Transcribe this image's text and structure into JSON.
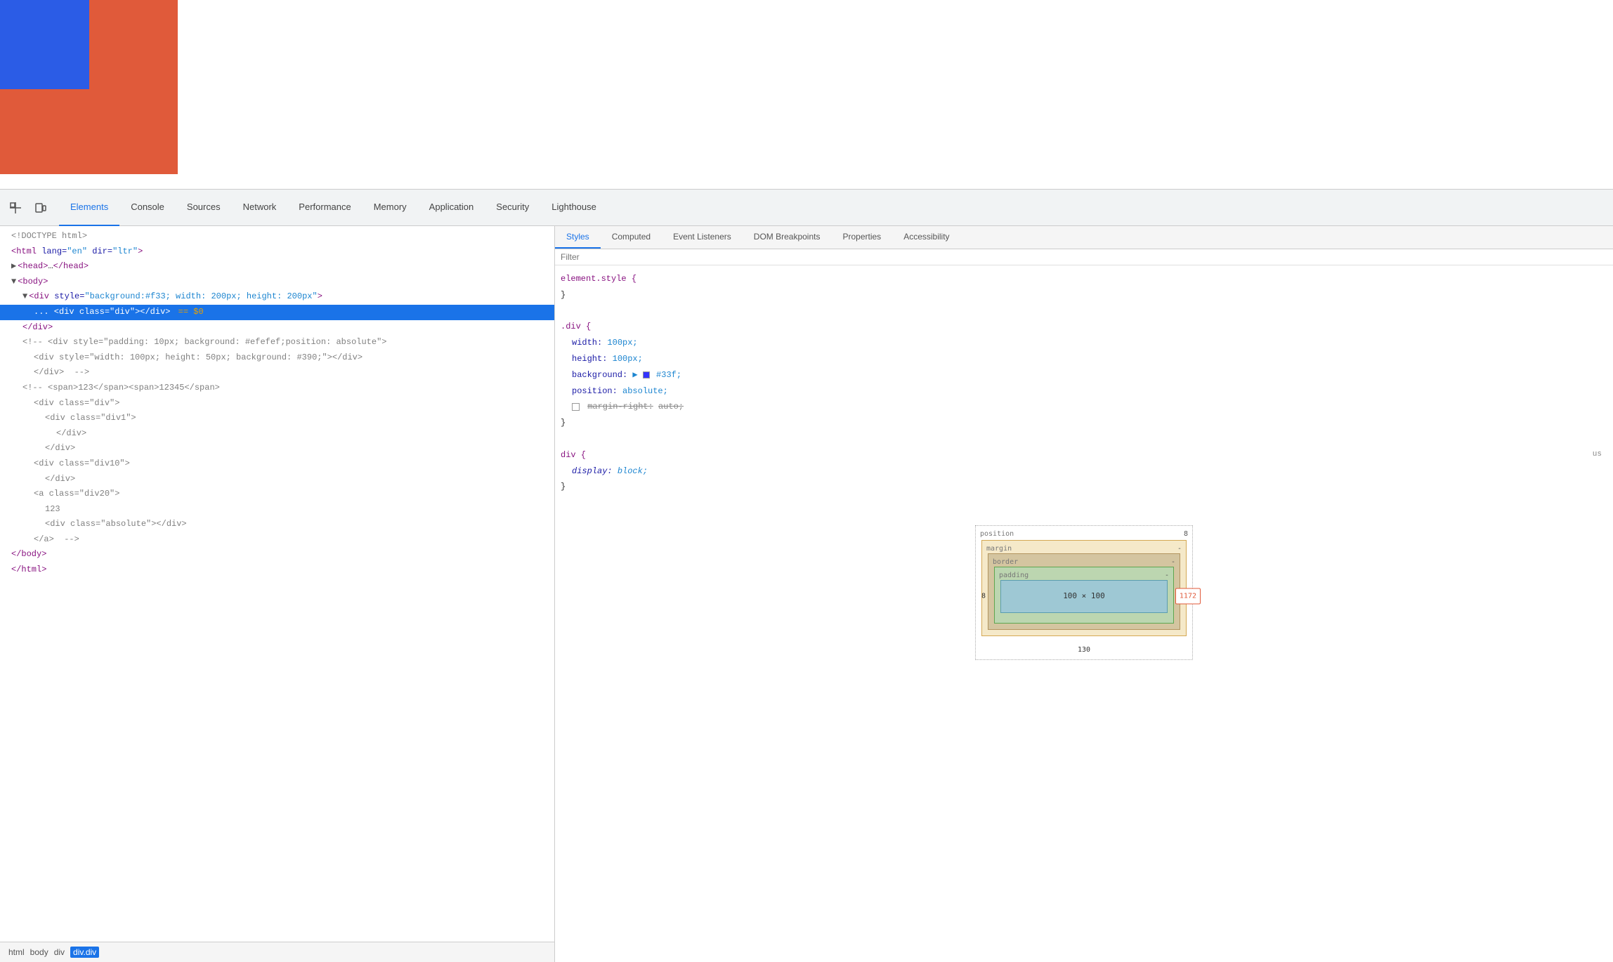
{
  "preview": {
    "redBox": {
      "color": "#e05a3a"
    },
    "blueBox": {
      "color": "#2b5ce6"
    }
  },
  "devtools": {
    "tabs": [
      {
        "id": "elements",
        "label": "Elements",
        "active": true
      },
      {
        "id": "console",
        "label": "Console",
        "active": false
      },
      {
        "id": "sources",
        "label": "Sources",
        "active": false
      },
      {
        "id": "network",
        "label": "Network",
        "active": false
      },
      {
        "id": "performance",
        "label": "Performance",
        "active": false
      },
      {
        "id": "memory",
        "label": "Memory",
        "active": false
      },
      {
        "id": "application",
        "label": "Application",
        "active": false
      },
      {
        "id": "security",
        "label": "Security",
        "active": false
      },
      {
        "id": "lighthouse",
        "label": "Lighthouse",
        "active": false
      }
    ]
  },
  "html_tree": {
    "lines": [
      {
        "text": "<!DOCTYPE html>",
        "indent": 0,
        "type": "doctype"
      },
      {
        "text": "<html lang=\"en\" dir=\"ltr\">",
        "indent": 0,
        "type": "tag",
        "tag": "html",
        "attrs": " lang=\"en\" dir=\"ltr\""
      },
      {
        "text": "▶ <head>…</head>",
        "indent": 1,
        "type": "collapsed"
      },
      {
        "text": "▼ <body>",
        "indent": 1,
        "type": "tag"
      },
      {
        "text": "▼ <div style=\"background:#f33; width: 200px; height: 200px\">",
        "indent": 2,
        "type": "tag"
      },
      {
        "text": "<div class=\"div\"></div>  == $0",
        "indent": 3,
        "type": "selected"
      },
      {
        "text": "</div>",
        "indent": 2,
        "type": "tag"
      },
      {
        "text": "<!-- <div style=\"padding: 10px; background: #efefef;position: absolute\">",
        "indent": 2,
        "type": "comment"
      },
      {
        "text": "<div style=\"width: 100px; height: 50px; background: #390;\"></div>",
        "indent": 3,
        "type": "comment"
      },
      {
        "text": "</div>  -->",
        "indent": 3,
        "type": "comment"
      },
      {
        "text": "<!-- <span>123</span><span>12345</span>",
        "indent": 2,
        "type": "comment"
      },
      {
        "text": "<div class=\"div\">",
        "indent": 3,
        "type": "comment"
      },
      {
        "text": "<div class=\"div1\">",
        "indent": 4,
        "type": "comment"
      },
      {
        "text": "</div>",
        "indent": 4,
        "type": "comment"
      },
      {
        "text": "</div>",
        "indent": 3,
        "type": "comment"
      },
      {
        "text": "<div class=\"div10\">",
        "indent": 3,
        "type": "comment"
      },
      {
        "text": "</div>",
        "indent": 3,
        "type": "comment"
      },
      {
        "text": "<a class=\"div20\">",
        "indent": 3,
        "type": "comment"
      },
      {
        "text": "123",
        "indent": 4,
        "type": "comment"
      },
      {
        "text": "<div class=\"absolute\"></div>",
        "indent": 4,
        "type": "comment"
      },
      {
        "text": "</a>  -->",
        "indent": 3,
        "type": "comment"
      },
      {
        "text": "</body>",
        "indent": 1,
        "type": "tag"
      },
      {
        "text": "</html>",
        "indent": 0,
        "type": "tag"
      }
    ]
  },
  "breadcrumb": {
    "items": [
      "html",
      "body",
      "div",
      "div.div"
    ]
  },
  "styles": {
    "sub_tabs": [
      {
        "id": "styles",
        "label": "Styles",
        "active": true
      },
      {
        "id": "computed",
        "label": "Computed",
        "active": false
      },
      {
        "id": "event-listeners",
        "label": "Event Listeners",
        "active": false
      },
      {
        "id": "dom-breakpoints",
        "label": "DOM Breakpoints",
        "active": false
      },
      {
        "id": "properties",
        "label": "Properties",
        "active": false
      },
      {
        "id": "accessibility",
        "label": "Accessibility",
        "active": false
      }
    ],
    "filter_placeholder": "Filter",
    "rules": [
      {
        "selector": "element.style {",
        "close": "}",
        "properties": []
      },
      {
        "selector": ".div {",
        "close": "}",
        "properties": [
          {
            "name": "width:",
            "value": "100px;"
          },
          {
            "name": "height:",
            "value": "100px;"
          },
          {
            "name": "background:",
            "value": "#33f;",
            "has_swatch": true,
            "swatch_color": "#3333ff"
          },
          {
            "name": "position:",
            "value": "absolute;"
          },
          {
            "name": "margin-right:",
            "value": "auto;",
            "strikethrough": true
          }
        ]
      },
      {
        "selector": "div {",
        "close": "}",
        "source": "us",
        "properties": [
          {
            "name": "display:",
            "value": "block;",
            "italic": true
          }
        ]
      }
    ],
    "box_model": {
      "position_label": "position",
      "position_value": "8",
      "margin_label": "margin",
      "margin_value": "-",
      "border_label": "border",
      "border_value": "-",
      "padding_label": "padding",
      "padding_value": "-",
      "content": "100 × 100",
      "left_value": "8",
      "right_value": "1172",
      "bottom_value": "130"
    }
  }
}
